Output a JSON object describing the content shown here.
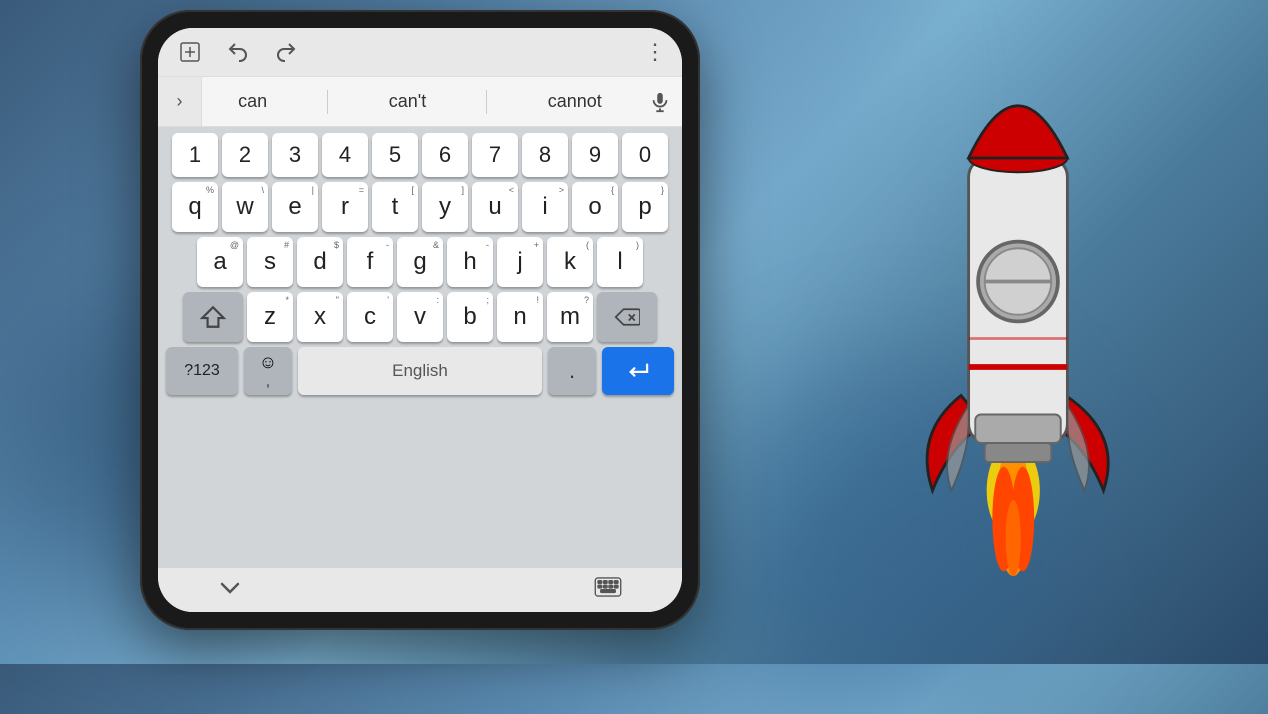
{
  "background": {
    "description": "Blurred blue gradient background"
  },
  "toolbar": {
    "add_icon": "⊞",
    "undo_icon": "↩",
    "redo_icon": "↪",
    "more_icon": "⋮"
  },
  "suggestions": {
    "expand_icon": "›",
    "items": [
      "can",
      "can't",
      "cannot"
    ],
    "mic_icon": "🎤"
  },
  "keyboard": {
    "numbers_row": [
      "1",
      "2",
      "3",
      "4",
      "5",
      "6",
      "7",
      "8",
      "9",
      "0"
    ],
    "row1_letters": [
      "q",
      "w",
      "e",
      "r",
      "t",
      "y",
      "u",
      "i",
      "o",
      "p"
    ],
    "row1_superscripts": [
      "%",
      "\\",
      "|",
      "=",
      "[",
      "]",
      "<",
      ">",
      "{",
      "}"
    ],
    "row2_letters": [
      "a",
      "s",
      "d",
      "f",
      "g",
      "h",
      "j",
      "k",
      "l"
    ],
    "row2_superscripts": [
      "@",
      "#",
      "$",
      "-",
      "&",
      "-",
      "+",
      "(",
      ")"
    ],
    "row3_letters": [
      "z",
      "x",
      "c",
      "v",
      "b",
      "n",
      "m"
    ],
    "row3_superscripts": [
      "*",
      "\"",
      "'",
      ":",
      ";",
      "!",
      "?"
    ],
    "shift_icon": "⇧",
    "backspace_icon": "⌫",
    "num_key_label": "?123",
    "space_label": "English",
    "period_label": ".",
    "enter_icon": "↵"
  },
  "nav_bar": {
    "chevron_down_icon": "∨",
    "keyboard_icon": "⌨"
  }
}
